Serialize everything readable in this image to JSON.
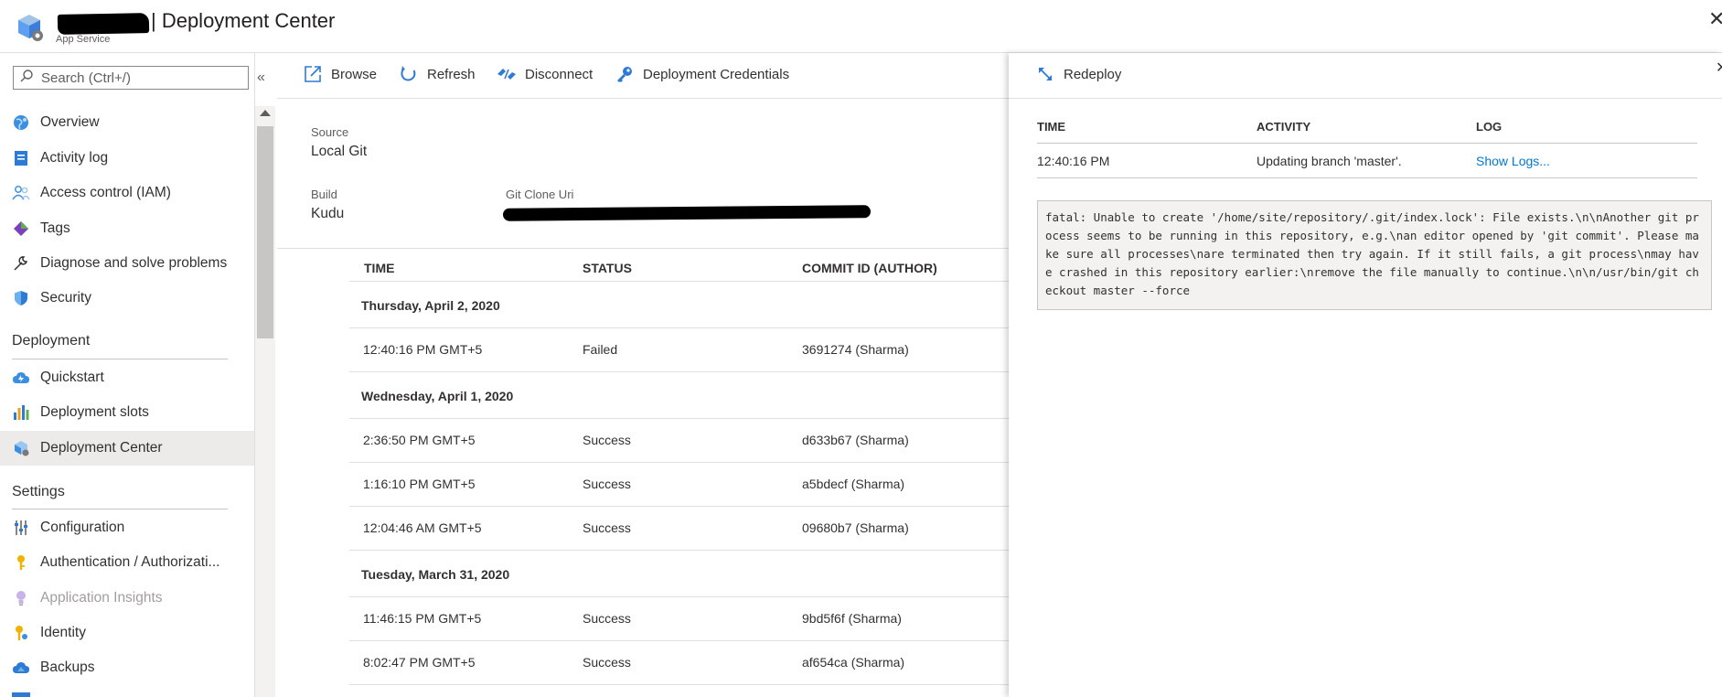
{
  "header": {
    "title": "| Deployment Center",
    "subtitle": "App Service",
    "close_glyph": "✕"
  },
  "sidebar": {
    "search_placeholder": "Search (Ctrl+/)",
    "collapse_glyph": "«",
    "items_top": [
      {
        "label": "Overview",
        "icon": "globe-icon"
      },
      {
        "label": "Activity log",
        "icon": "activity-log-icon"
      },
      {
        "label": "Access control (IAM)",
        "icon": "people-icon"
      },
      {
        "label": "Tags",
        "icon": "tag-icon"
      },
      {
        "label": "Diagnose and solve problems",
        "icon": "wrench-icon"
      },
      {
        "label": "Security",
        "icon": "shield-icon"
      }
    ],
    "section_deployment": "Deployment",
    "items_deployment": [
      {
        "label": "Quickstart",
        "icon": "cloud-bolt-icon"
      },
      {
        "label": "Deployment slots",
        "icon": "bar-chart-icon"
      },
      {
        "label": "Deployment Center",
        "icon": "deployment-center-icon",
        "selected": true
      }
    ],
    "section_settings": "Settings",
    "items_settings": [
      {
        "label": "Configuration",
        "icon": "sliders-icon"
      },
      {
        "label": "Authentication / Authorizati...",
        "icon": "key-icon"
      },
      {
        "label": "Application Insights",
        "icon": "lightbulb-icon",
        "disabled": true
      },
      {
        "label": "Identity",
        "icon": "identity-key-icon"
      },
      {
        "label": "Backups",
        "icon": "cloud-backup-icon"
      }
    ]
  },
  "toolbar": {
    "browse": "Browse",
    "refresh": "Refresh",
    "disconnect": "Disconnect",
    "credentials": "Deployment Credentials"
  },
  "settings": {
    "source_label": "Source",
    "source_value": "Local Git",
    "build_label": "Build",
    "build_value": "Kudu",
    "git_label": "Git Clone Uri"
  },
  "history": {
    "columns": [
      "TIME",
      "STATUS",
      "COMMIT ID (AUTHOR)"
    ],
    "groups": [
      {
        "date": "Thursday, April 2, 2020",
        "rows": [
          {
            "time": "12:40:16 PM GMT+5",
            "status": "Failed",
            "commit": "3691274 (Sharma)"
          }
        ]
      },
      {
        "date": "Wednesday, April 1, 2020",
        "rows": [
          {
            "time": "2:36:50 PM GMT+5",
            "status": "Success",
            "commit": "d633b67 (Sharma)"
          },
          {
            "time": "1:16:10 PM GMT+5",
            "status": "Success",
            "commit": "a5bdecf (Sharma)"
          },
          {
            "time": "12:04:46 AM GMT+5",
            "status": "Success",
            "commit": "09680b7 (Sharma)"
          }
        ]
      },
      {
        "date": "Tuesday, March 31, 2020",
        "rows": [
          {
            "time": "11:46:15 PM GMT+5",
            "status": "Success",
            "commit": "9bd5f6f (Sharma)"
          },
          {
            "time": "8:02:47 PM GMT+5",
            "status": "Success",
            "commit": "af654ca (Sharma)"
          }
        ]
      }
    ]
  },
  "blade": {
    "redeploy": "Redeploy",
    "close_glyph": "✕",
    "columns": [
      "TIME",
      "ACTIVITY",
      "LOG"
    ],
    "row": {
      "time": "12:40:16 PM",
      "activity": "Updating branch 'master'.",
      "log_link": "Show Logs..."
    },
    "log_text": "fatal: Unable to create '/home/site/repository/.git/index.lock': File exists.\\n\\nAnother git process seems to be running in this repository, e.g.\\nan editor opened by 'git commit'. Please make sure all processes\\nare terminated then try again. If it still fails, a git process\\nmay have crashed in this repository earlier:\\nremove the file manually to continue.\\n\\n/usr/bin/git checkout master --force"
  },
  "colors": {
    "accent": "#0078d4",
    "selected_bg": "#edebe9",
    "border": "#e1dfdd"
  }
}
